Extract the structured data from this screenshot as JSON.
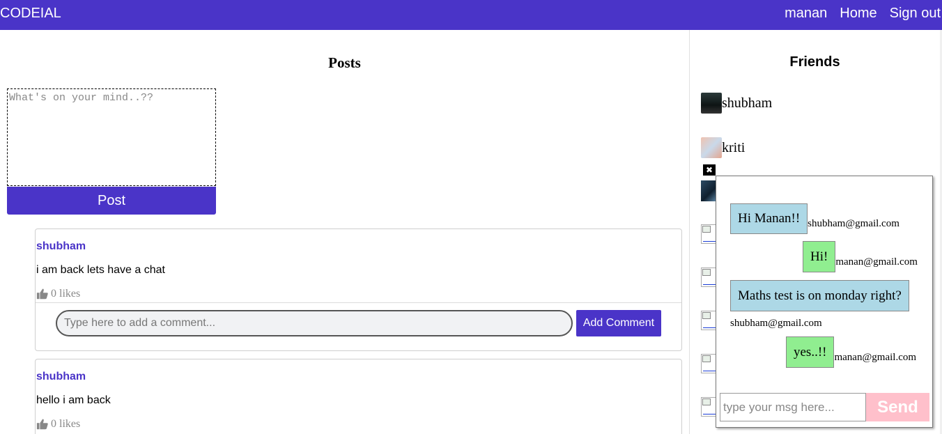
{
  "navbar": {
    "brand": "CODEIAL",
    "links": [
      "manan",
      "Home",
      "Sign out"
    ]
  },
  "posts_section": {
    "title": "Posts",
    "form": {
      "placeholder": "What's on your mind..??",
      "button_label": "Post"
    },
    "posts": [
      {
        "author": "shubham",
        "content": "i am back lets have a chat",
        "likes": "0 likes",
        "comment_placeholder": "Type here to add a comment...",
        "comment_button": "Add Comment"
      },
      {
        "author": "shubham",
        "content": "hello i am back",
        "likes": "0 likes"
      }
    ]
  },
  "friends_section": {
    "title": "Friends",
    "friends": [
      {
        "name": "shubham"
      },
      {
        "name": "kriti"
      }
    ]
  },
  "chat": {
    "close_icon": "close-icon",
    "messages": [
      {
        "text": "Hi Manan!!",
        "sender": "shubham@gmail.com",
        "type": "other"
      },
      {
        "text": "Hi!",
        "sender": "manan@gmail.com",
        "type": "self"
      },
      {
        "text": "Maths test is on monday right?",
        "sender": "shubham@gmail.com",
        "type": "other"
      },
      {
        "text": "yes..!!",
        "sender": "manan@gmail.com",
        "type": "self"
      }
    ],
    "input_placeholder": "type your msg here...",
    "send_label": "Send"
  },
  "colors": {
    "brand": "#4a34c8",
    "other_bubble": "#add8e6",
    "self_bubble": "#90ee90",
    "send_button": "#ffc0cb"
  }
}
